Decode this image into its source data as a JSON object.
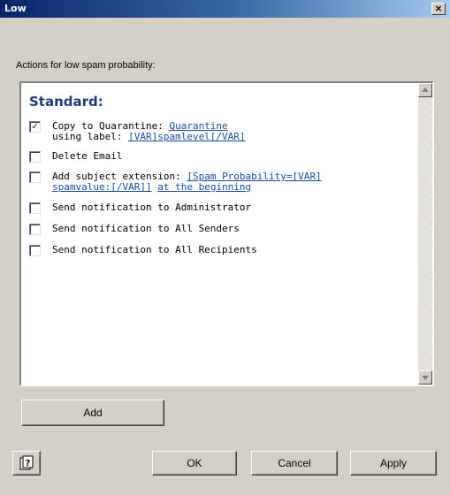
{
  "window": {
    "title": "Low",
    "close_label": "×"
  },
  "description": "Actions for low spam probability:",
  "group": {
    "title": "Standard:"
  },
  "actions": [
    {
      "checked": true,
      "text": "Copy to Quarantine: ",
      "link": "Quarantine",
      "line2_text": "using label: ",
      "line2_link": "[VAR]spamlevel[/VAR]",
      "line2_text_after": ""
    },
    {
      "checked": false,
      "text": "Delete Email",
      "link": ""
    },
    {
      "checked": false,
      "text": "Add subject extension: ",
      "link": "[Spam Probability=[VAR]",
      "line2_text": "",
      "line2_link": "spamvalue:[/VAR]]",
      "line2_text_after": " ",
      "line2_link2": "at the beginning"
    },
    {
      "checked": false,
      "text": "Send notification to Administrator",
      "link": ""
    },
    {
      "checked": false,
      "text": "Send notification to All Senders",
      "link": ""
    },
    {
      "checked": false,
      "text": "Send notification to All Recipients",
      "link": ""
    }
  ],
  "buttons": {
    "add": "Add",
    "ok": "OK",
    "cancel": "Cancel",
    "apply": "Apply"
  },
  "icons": {
    "help": "help-context-icon"
  }
}
